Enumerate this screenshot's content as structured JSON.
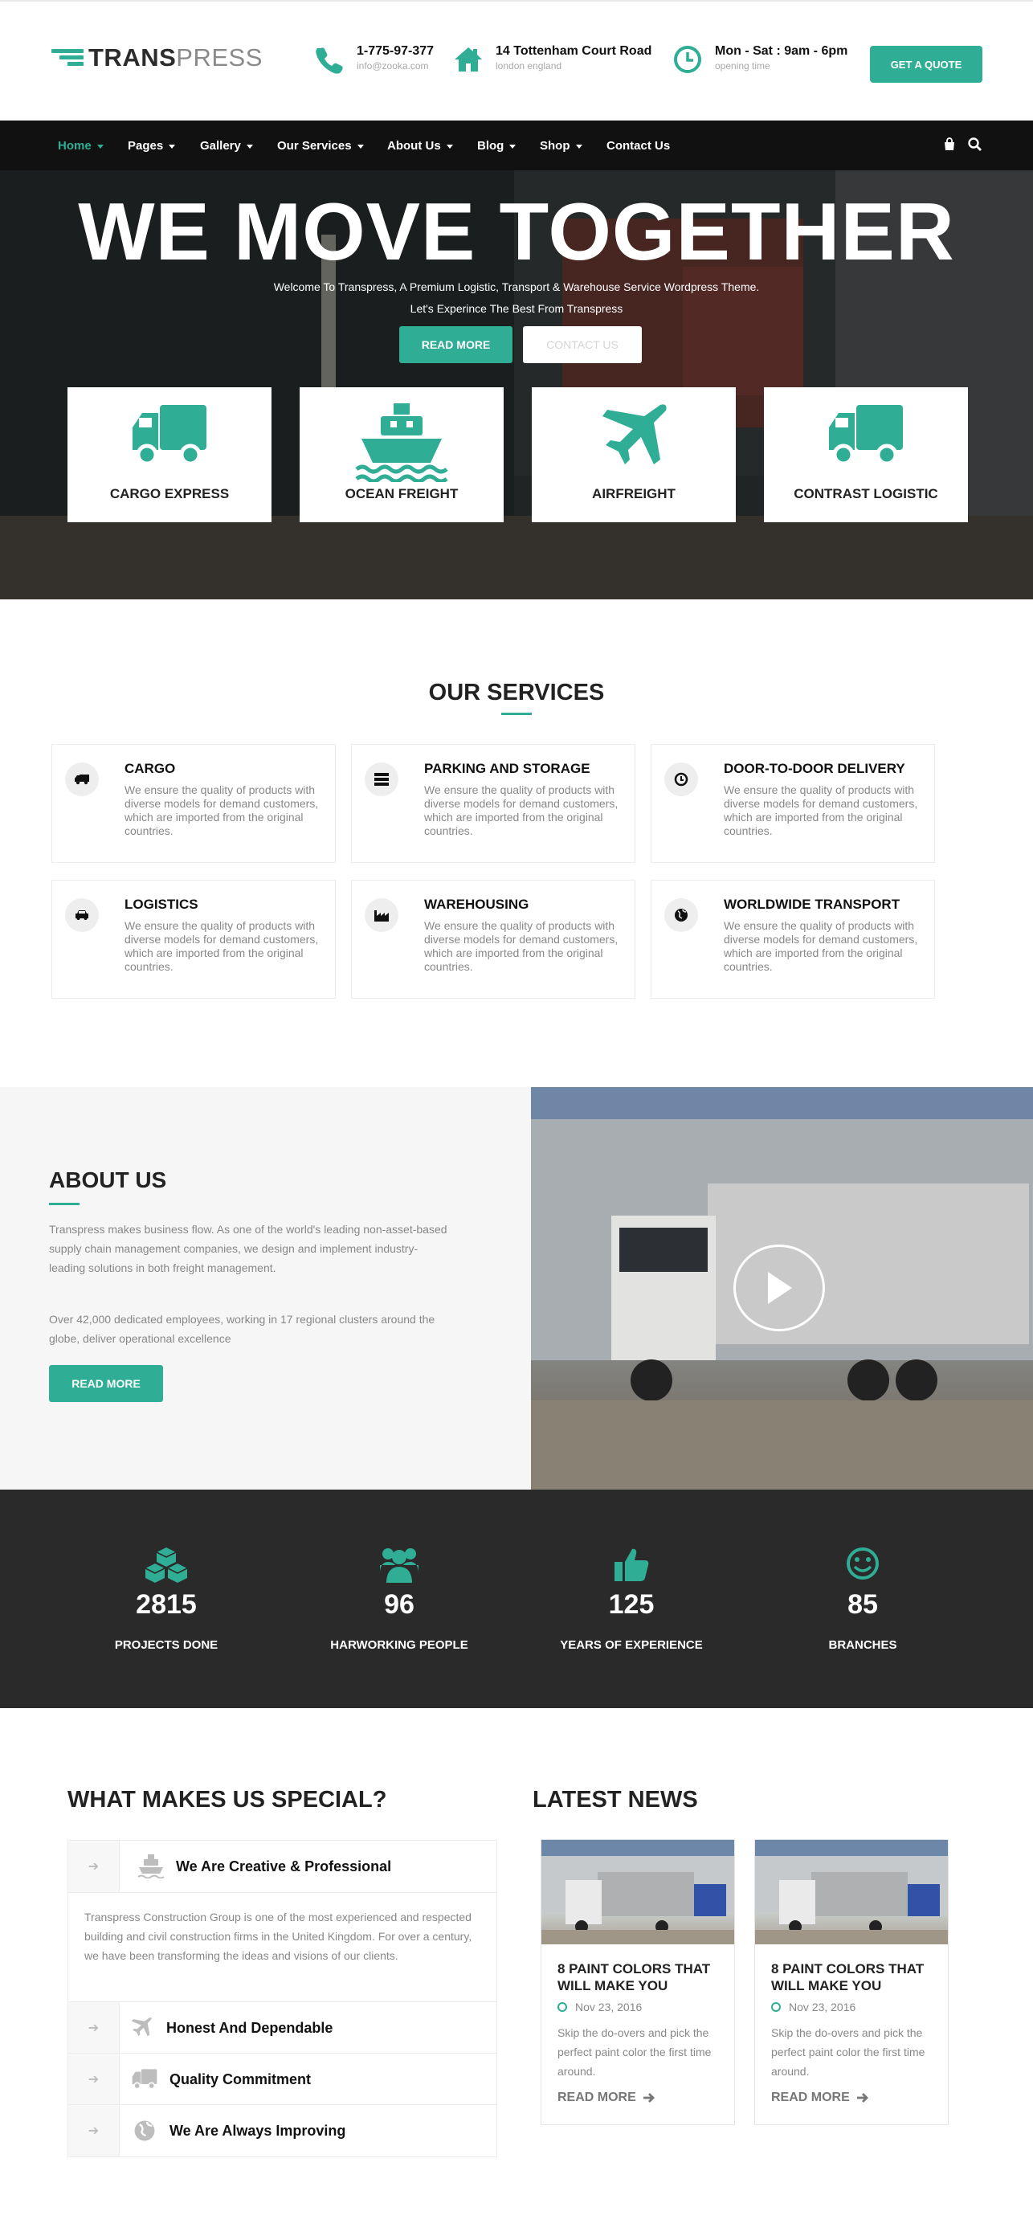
{
  "header": {
    "logo_bold": "TRANS",
    "logo_light": "PRESS",
    "phone": {
      "title": "1-775-97-377",
      "sub": "info@zooka.com"
    },
    "address": {
      "title": "14 Tottenham Court Road",
      "sub": "london england"
    },
    "hours": {
      "title": "Mon - Sat : 9am - 6pm",
      "sub": "opening time"
    },
    "quote_button": "GET A QUOTE"
  },
  "nav": {
    "items": [
      {
        "label": "Home",
        "active": true
      },
      {
        "label": "Pages"
      },
      {
        "label": "Gallery"
      },
      {
        "label": "Our Services"
      },
      {
        "label": "About Us"
      },
      {
        "label": "Blog"
      },
      {
        "label": "Shop"
      },
      {
        "label": "Contact Us"
      }
    ]
  },
  "hero": {
    "title": "WE MOVE TOGETHER",
    "subtitle1": "Welcome To Transpress, A Premium Logistic, Transport & Warehouse Service Wordpress Theme.",
    "subtitle2": "Let's Experince The Best From Transpress",
    "btn_primary": "READ MORE",
    "btn_secondary": "CONTACT US",
    "cards": [
      {
        "label": "CARGO EXPRESS",
        "icon": "truck-icon"
      },
      {
        "label": "OCEAN FREIGHT",
        "icon": "ship-icon"
      },
      {
        "label": "AIRFREIGHT",
        "icon": "plane-icon"
      },
      {
        "label": "CONTRAST LOGISTIC",
        "icon": "truck-icon"
      }
    ]
  },
  "services": {
    "title": "OUR SERVICES",
    "items": [
      {
        "title": "CARGO",
        "text": "We ensure the quality of products with diverse models for demand customers, which are imported from the original countries.",
        "icon": "truck-icon"
      },
      {
        "title": "PARKING AND STORAGE",
        "text": "We ensure the quality of products with diverse models for demand customers, which are imported from the original countries.",
        "icon": "storage-icon"
      },
      {
        "title": "DOOR-TO-DOOR DELIVERY",
        "text": "We ensure the quality of products with diverse models for demand customers, which are imported from the original countries.",
        "icon": "clock-icon"
      },
      {
        "title": "LOGISTICS",
        "text": "We ensure the quality of products with diverse models for demand customers, which are imported from the original countries.",
        "icon": "car-icon"
      },
      {
        "title": "WAREHOUSING",
        "text": "We ensure the quality of products with diverse models for demand customers, which are imported from the original countries.",
        "icon": "factory-icon"
      },
      {
        "title": "WORLDWIDE TRANSPORT",
        "text": "We ensure the quality of products with diverse models for demand customers, which are imported from the original countries.",
        "icon": "globe-icon"
      }
    ]
  },
  "about": {
    "title": "ABOUT US",
    "p1": "Transpress makes business flow. As one of the world's leading non-asset-based supply chain management companies, we design and implement industry-leading solutions in both freight management.",
    "p2": "Over 42,000 dedicated employees, working in 17 regional clusters around the globe, deliver operational excellence",
    "button": "READ MORE"
  },
  "stats": [
    {
      "number": "2815",
      "label": "PROJECTS DONE",
      "icon": "cubes-icon"
    },
    {
      "number": "96",
      "label": "HARWORKING PEOPLE",
      "icon": "users-icon"
    },
    {
      "number": "125",
      "label": "YEARS OF EXPERIENCE",
      "icon": "thumbs-up-icon"
    },
    {
      "number": "85",
      "label": "BRANCHES",
      "icon": "smile-icon"
    }
  ],
  "special": {
    "title": "WHAT MAKES US SPECIAL?",
    "items": [
      {
        "title": "We Are Creative & Professional",
        "icon": "ship-icon",
        "body": "Transpress Construction Group is one of the most experienced and respected building and civil construction firms in the United Kingdom. For over a century, we have been transforming the ideas and visions of our clients."
      },
      {
        "title": "Honest And Dependable",
        "icon": "plane-icon"
      },
      {
        "title": "Quality Commitment",
        "icon": "truck-icon"
      },
      {
        "title": "We Are Always Improving",
        "icon": "globe-icon"
      }
    ]
  },
  "news": {
    "title": "LATEST NEWS",
    "items": [
      {
        "title": "8 PAINT COLORS THAT WILL MAKE YOU",
        "date": "Nov 23, 2016",
        "excerpt": "Skip the do-overs and pick the perfect paint color the first time around.",
        "more": "READ MORE"
      },
      {
        "title": "8 PAINT COLORS THAT WILL MAKE YOU",
        "date": "Nov 23, 2016",
        "excerpt": "Skip the do-overs and pick the perfect paint color the first time around.",
        "more": "READ MORE"
      }
    ]
  },
  "colors": {
    "accent": "#2fae95",
    "dark": "#111111",
    "stats_bg": "#2a2a2a"
  }
}
